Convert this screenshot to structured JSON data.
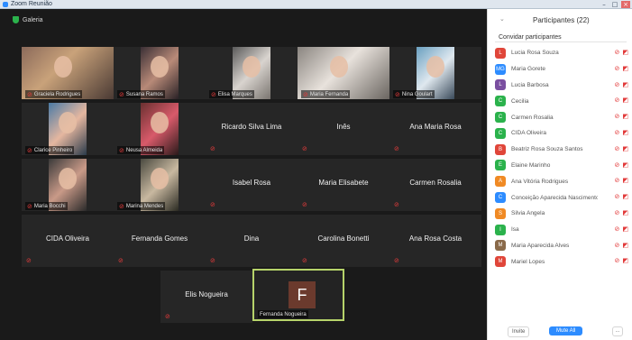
{
  "window": {
    "title": "Zoom Reunião"
  },
  "topbar": {
    "view_label": "Galeria",
    "shield_icon": "shield-icon"
  },
  "tiles": [
    {
      "name": "Graciela Rodrigues",
      "muted": true,
      "video": true
    },
    {
      "name": "Susana Ramos",
      "muted": true,
      "video": true
    },
    {
      "name": "Elisa Marques",
      "muted": true,
      "video": true
    },
    {
      "name": "Maria Fernanda",
      "muted": true,
      "video": true
    },
    {
      "name": "Nina Goulart",
      "muted": true,
      "video": true
    },
    {
      "name": "Clarice Pinheiro",
      "muted": true,
      "video": true
    },
    {
      "name": "Neusa Almeida",
      "muted": true,
      "video": true
    },
    {
      "name": "Ricardo Silva Lima",
      "muted": true,
      "video": false
    },
    {
      "name": "Inês",
      "muted": true,
      "video": false
    },
    {
      "name": "Ana Maria Rosa",
      "muted": true,
      "video": false
    },
    {
      "name": "Maria Bocchi",
      "muted": true,
      "video": true
    },
    {
      "name": "Marina Mendes",
      "muted": true,
      "video": true
    },
    {
      "name": "Isabel Rosa",
      "muted": true,
      "video": false
    },
    {
      "name": "Maria Elisabete",
      "muted": true,
      "video": false
    },
    {
      "name": "Carmen Rosalia",
      "muted": true,
      "video": false
    },
    {
      "name": "CIDA Oliveira",
      "muted": true,
      "video": false
    },
    {
      "name": "Fernanda Gomes",
      "muted": true,
      "video": false
    },
    {
      "name": "Dina",
      "muted": true,
      "video": false
    },
    {
      "name": "Carolina Bonetti",
      "muted": true,
      "video": false
    },
    {
      "name": "Ana Rosa Costa",
      "muted": true,
      "video": false
    },
    {
      "name": "Elis Nogueira",
      "muted": true,
      "video": false
    },
    {
      "name": "Fernanda Nogueira",
      "muted": false,
      "video": false,
      "avatar_letter": "F",
      "active": true
    }
  ],
  "panel": {
    "title": "Participantes (22)",
    "collapse_icon": "chevron-down-icon",
    "invite_header": "Convidar participantes",
    "participants": [
      {
        "name": "Lucia Rosa Souza",
        "color": "#e0463a",
        "initial": "L"
      },
      {
        "name": "Maria Gorete",
        "color": "#2d8cff",
        "initial": "MG"
      },
      {
        "name": "Lucia Barbosa",
        "color": "#7a4fa0",
        "initial": "L"
      },
      {
        "name": "Cecilia",
        "color": "#2bb24c",
        "initial": "C"
      },
      {
        "name": "Carmen Rosalia",
        "color": "#2bb24c",
        "initial": "C"
      },
      {
        "name": "CIDA Oliveira",
        "color": "#2bb24c",
        "initial": "C"
      },
      {
        "name": "Beatriz Rosa Souza Santos",
        "color": "#e0463a",
        "initial": "B"
      },
      {
        "name": "Elaine Marinho",
        "color": "#2bb24c",
        "initial": "E"
      },
      {
        "name": "Ana Vitória Rodrigues",
        "color": "#f08a24",
        "initial": "A"
      },
      {
        "name": "Conceição Aparecida Nascimento",
        "color": "#2d8cff",
        "initial": "C"
      },
      {
        "name": "Silvia Angela",
        "color": "#f08a24",
        "initial": "S"
      },
      {
        "name": "Isa",
        "color": "#2bb24c",
        "initial": "I"
      },
      {
        "name": "Maria Aparecida Alves",
        "color": "#8a6a4a",
        "initial": "M"
      },
      {
        "name": "Mariel Lopes",
        "color": "#e0463a",
        "initial": "M"
      }
    ],
    "footer": {
      "invite_label": "Invite",
      "mute_all_label": "Mute All",
      "more_label": "..."
    }
  }
}
